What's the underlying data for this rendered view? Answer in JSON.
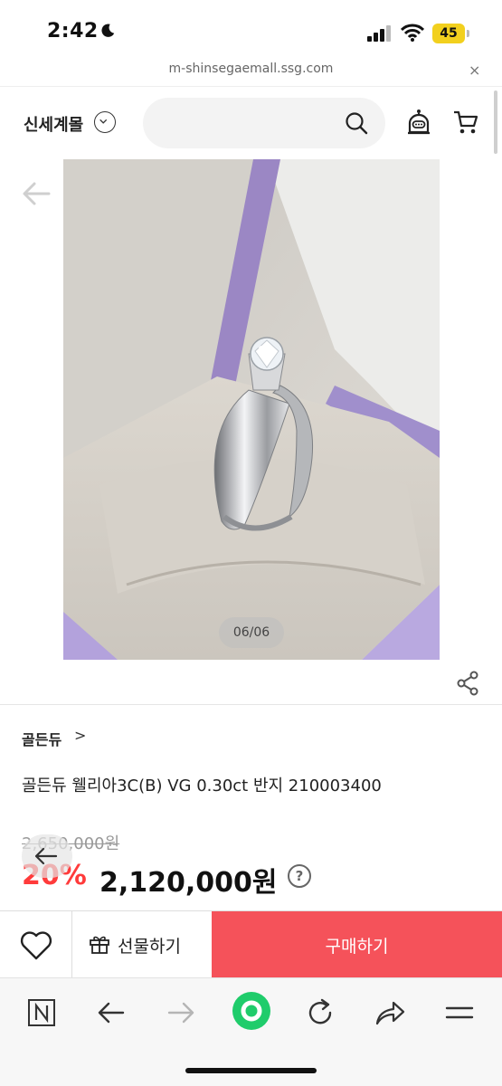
{
  "status_bar": {
    "time": "2:42",
    "battery": "45"
  },
  "url_bar": {
    "domain": "m-shinsegaemall.ssg.com",
    "close_glyph": "×"
  },
  "header": {
    "brand": "신세계몰",
    "icons": [
      "chevron-down-icon",
      "search-icon",
      "chatbot-icon",
      "cart-icon"
    ]
  },
  "gallery": {
    "counter": "06/06"
  },
  "product": {
    "brand_link": "골든듀",
    "brand_link_chevron": ">",
    "name": "골든듀 웰리아3C(B) VG 0.30ct 반지 210003400",
    "original_price": "2,650,000원",
    "discount": "20%",
    "sale_price": "2,120,000원",
    "help_glyph": "?"
  },
  "action_bar": {
    "gift_label": "선물하기",
    "buy_label": "구매하기",
    "buy_color": "#f5525a"
  },
  "nav_bar": {
    "icons": [
      "n-icon",
      "back-arrow-icon",
      "forward-arrow-icon",
      "home-dot-icon",
      "refresh-icon",
      "share-arrow-icon",
      "menu-icon"
    ],
    "accent": "#1fcc6b"
  }
}
